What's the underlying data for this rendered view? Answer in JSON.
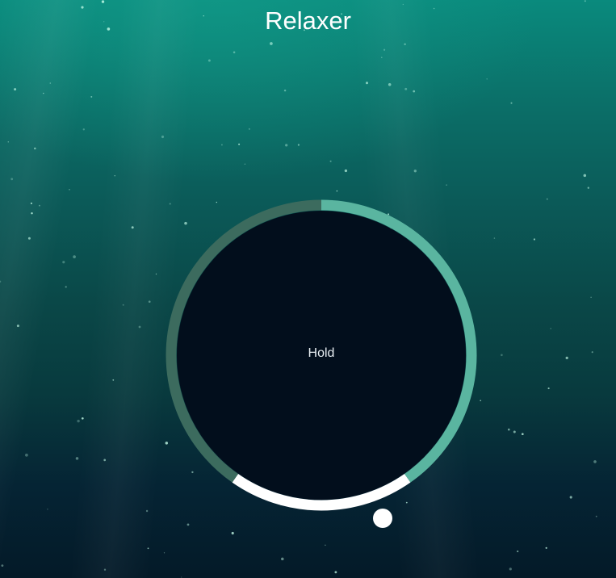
{
  "app": {
    "title": "Relaxer"
  },
  "breathing": {
    "phase_label": "Hold",
    "progress_fraction": 0.25
  },
  "colors": {
    "background_top": "#0a8a7d",
    "background_bottom": "#041a28",
    "circle_fill": "#020e1c",
    "ring_breathe_in": "#5ab5a0",
    "ring_breathe_out": "#3c6b5e",
    "ring_hold": "#ffffff",
    "pointer": "#ffffff",
    "text": "#ffffff"
  }
}
